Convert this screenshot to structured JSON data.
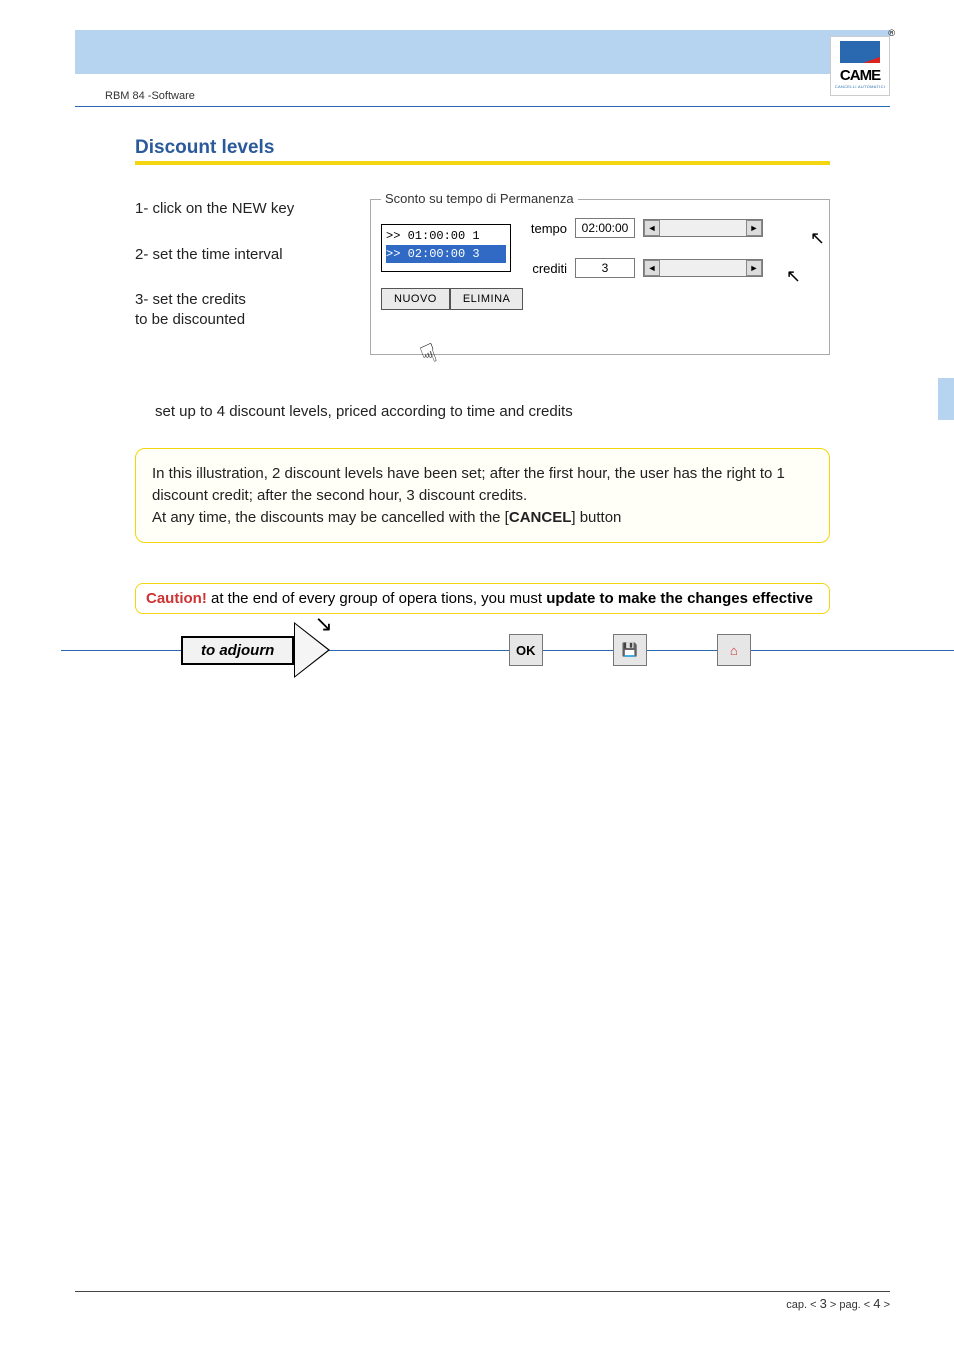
{
  "header": {
    "product_label": "RBM 84 -Software",
    "logo_text": "CAME",
    "logo_sub": "CANCELLI AUTOMATICI",
    "registered_mark": "®"
  },
  "section_title": "Discount levels",
  "instructions": {
    "line1": "1- click on the NEW key",
    "line2": "2- set the time interval",
    "line3a": "3- set the credits",
    "line3b": "to be discounted"
  },
  "panel": {
    "legend": "Sconto su tempo di Permanenza",
    "list_row1": ">> 01:00:00   1",
    "list_row2": ">> 02:00:00   3",
    "tempo_label": "tempo",
    "tempo_value": "02:00:00",
    "crediti_label": "crediti",
    "crediti_value": "3",
    "btn_nuovo": "NUOVO",
    "btn_elimina": "ELIMINA"
  },
  "midtext": "set up to 4 discount levels, priced according to time and credits",
  "info": {
    "p1a": " In this illustration, 2 discount levels have been set; after the first hour, the user has the right to 1 discount credit; after the second hour, 3 discount credits.",
    "p2a": "At any time, the discounts may be cancelled with the [",
    "p2b": "CANCEL",
    "p2c": "] button"
  },
  "caution": {
    "lead": "Caution!",
    "mid": " at the end of every group of opera tions, you must ",
    "bold": "update to make the changes effective"
  },
  "flow": {
    "adjourn": "to adjourn",
    "ok": "OK"
  },
  "footer": {
    "cap_label": "cap. < ",
    "cap_num": "3",
    "cap_tail": " > pag. < ",
    "pag_num": "4",
    "pag_tail": " >"
  }
}
